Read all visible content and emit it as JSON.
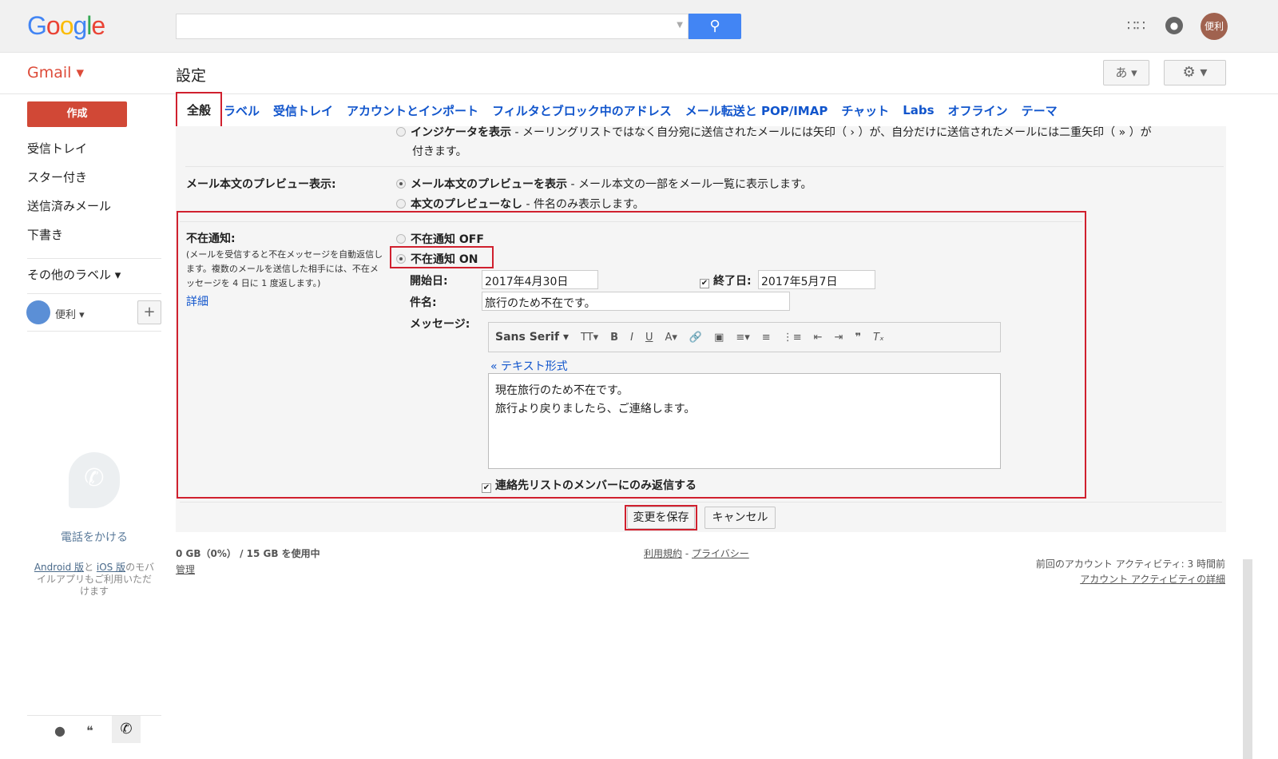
{
  "header": {
    "logo": "Google",
    "search_value": "",
    "avatar_label": "便利"
  },
  "subheader": {
    "app_name": "Gmail ▾",
    "page_title": "設定",
    "ime_label": "あ ▾",
    "gear_label": "⚙ ▾"
  },
  "sidebar": {
    "compose": "作成",
    "items": [
      "受信トレイ",
      "スター付き",
      "送信済みメール",
      "下書き"
    ],
    "more_labels": "その他のラベル ▾",
    "user_name": "便利 ▾",
    "add": "+",
    "call_label": "電話をかける",
    "mobile_android": "Android 版",
    "mobile_and": "と",
    "mobile_ios": "iOS 版",
    "mobile_rest": "のモバイルアプリもご利用いただけます"
  },
  "tabs": [
    "全般",
    "ラベル",
    "受信トレイ",
    "アカウントとインポート",
    "フィルタとブロック中のアドレス",
    "メール転送と POP/IMAP",
    "チャット",
    "Labs",
    "オフライン",
    "テーマ"
  ],
  "settings": {
    "indicator": {
      "bold": "インジケータを表示",
      "desc": " - メーリングリストではなく自分宛に送信されたメールには矢印（ › ）が、自分だけに送信されたメールには二重矢印（ » ）が",
      "desc2": "付きます。"
    },
    "preview": {
      "label": "メール本文のプレビュー表示:",
      "opt1_bold": "メール本文のプレビューを表示",
      "opt1_desc": " - メール本文の一部をメール一覧に表示します。",
      "opt2_bold": "本文のプレビューなし",
      "opt2_desc": " - 件名のみ表示します。"
    },
    "vacation": {
      "label": "不在通知:",
      "desc": "(メールを受信すると不在メッセージを自動返信します。複数のメールを送信した相手には、不在メッセージを 4 日に 1 度返します。)",
      "details": "詳細",
      "off": "不在通知 OFF",
      "on": "不在通知 ON",
      "start_label": "開始日:",
      "start_value": "2017年4月30日",
      "end_label": "終了日:",
      "end_value": "2017年5月7日",
      "subject_label": "件名:",
      "subject_value": "旅行のため不在です。",
      "message_label": "メッセージ:",
      "font": "Sans Serif ▾",
      "text_mode": "« テキスト形式",
      "message_lines": [
        "現在旅行のため不在です。",
        "旅行より戻りましたら、ご連絡します。"
      ],
      "contacts_only": "連絡先リストのメンバーにのみ返信する"
    },
    "save": "変更を保存",
    "cancel": "キャンセル"
  },
  "footer": {
    "storage": "0 GB（0%） / 15 GB を使用中",
    "manage": "管理",
    "terms": "利用規約",
    "dash": " - ",
    "privacy": "プライバシー",
    "last_activity": "前回のアカウント アクティビティ: 3 時間前",
    "activity_details": "アカウント アクティビティの詳細"
  }
}
